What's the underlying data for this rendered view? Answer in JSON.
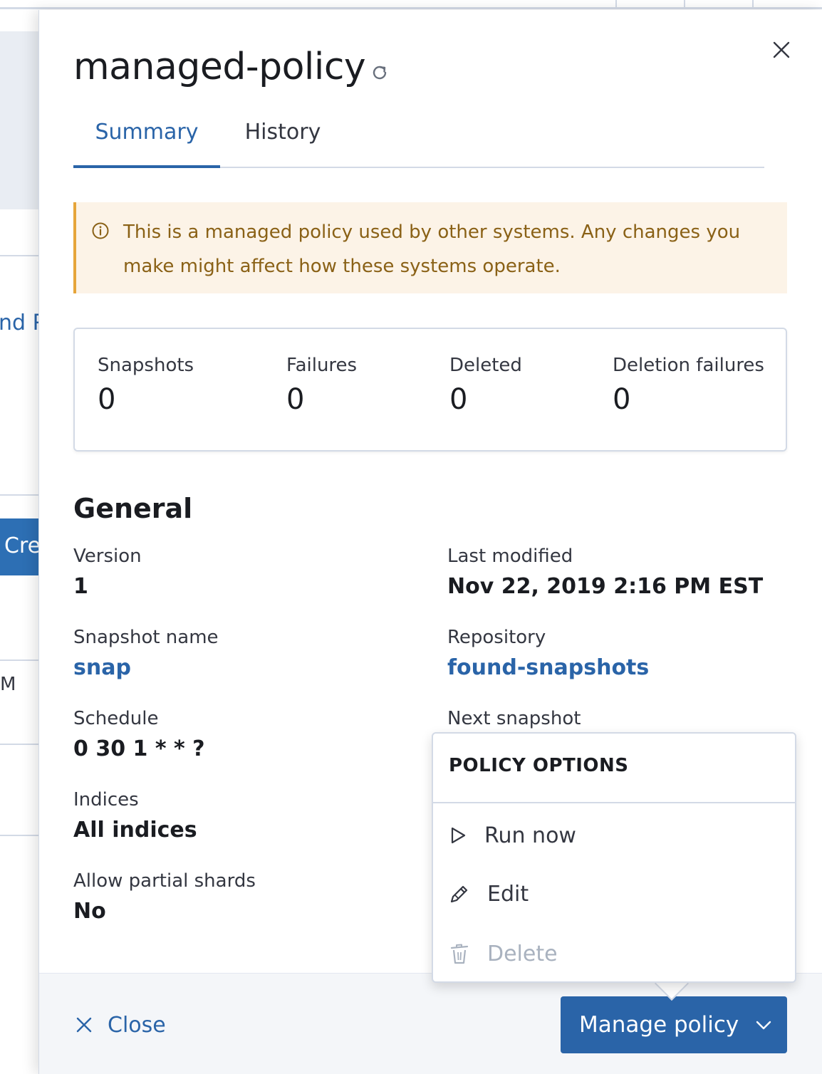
{
  "background": {
    "text_fragment_1": "nd P",
    "button_fragment": "Cre",
    "text_fragment_2": "M"
  },
  "flyout": {
    "title": "managed-policy",
    "tabs": [
      {
        "label": "Summary",
        "active": true
      },
      {
        "label": "History",
        "active": false
      }
    ],
    "callout": {
      "text": "This is a managed policy used by other systems. Any changes you make might affect how these systems operate.",
      "color": "#8a6116"
    },
    "stats": [
      {
        "label": "Snapshots",
        "value": "0"
      },
      {
        "label": "Failures",
        "value": "0"
      },
      {
        "label": "Deleted",
        "value": "0"
      },
      {
        "label": "Deletion failures",
        "value": "0"
      }
    ],
    "general": {
      "title": "General",
      "version": {
        "label": "Version",
        "value": "1"
      },
      "last_modified": {
        "label": "Last modified",
        "value": "Nov 22, 2019 2:16 PM EST"
      },
      "snapshot_name": {
        "label": "Snapshot name",
        "value": "snap"
      },
      "repository": {
        "label": "Repository",
        "value": "found-snapshots"
      },
      "schedule": {
        "label": "Schedule",
        "value": "0 30 1 * * ?"
      },
      "next_snapshot": {
        "label": "Next snapshot"
      },
      "indices": {
        "label": "Indices",
        "value": "All indices"
      },
      "allow_partial_shards": {
        "label": "Allow partial shards",
        "value": "No"
      }
    },
    "footer": {
      "close_label": "Close",
      "manage_label": "Manage policy"
    },
    "popover": {
      "title": "POLICY OPTIONS",
      "items": [
        {
          "label": "Run now",
          "icon": "play-icon",
          "disabled": false
        },
        {
          "label": "Edit",
          "icon": "pencil-icon",
          "disabled": false
        },
        {
          "label": "Delete",
          "icon": "trash-icon",
          "disabled": true
        }
      ]
    },
    "colors": {
      "primary": "#2a64a8",
      "warning_bg": "#fcf3e7",
      "warning_border": "#e6a53a",
      "border": "#d3dae6"
    }
  }
}
